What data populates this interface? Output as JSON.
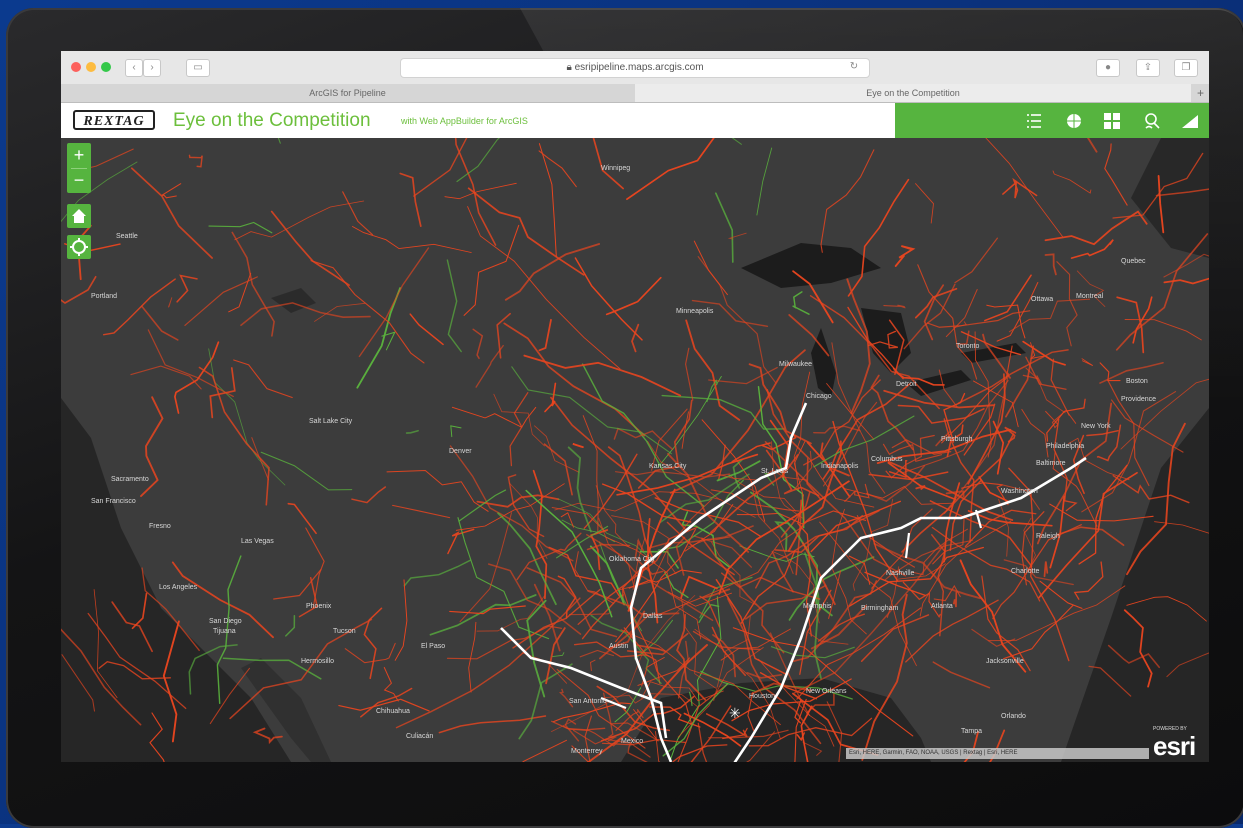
{
  "browser": {
    "url": "esripipeline.maps.arcgis.com",
    "tabs": [
      {
        "label": "ArcGIS for Pipeline",
        "active": false
      },
      {
        "label": "Eye on the Competition",
        "active": true
      }
    ]
  },
  "app": {
    "logo_text": "REXTAG",
    "title": "Eye on the Competition",
    "subtitle": "with Web AppBuilder for ArcGIS",
    "toolbar_icons": [
      "list-icon",
      "globe-icon",
      "grid-icon",
      "layers-icon",
      "signal-icon"
    ],
    "accent_color": "#56b43f"
  },
  "map_controls": {
    "zoom_in": "+",
    "zoom_out": "−"
  },
  "cities": [
    {
      "name": "Seattle"
    },
    {
      "name": "Portland"
    },
    {
      "name": "Winnipeg"
    },
    {
      "name": "Minneapolis"
    },
    {
      "name": "Milwaukee"
    },
    {
      "name": "Chicago"
    },
    {
      "name": "Detroit"
    },
    {
      "name": "Toronto"
    },
    {
      "name": "Ottawa"
    },
    {
      "name": "Montreal"
    },
    {
      "name": "Quebec"
    },
    {
      "name": "Boston"
    },
    {
      "name": "Providence"
    },
    {
      "name": "New York"
    },
    {
      "name": "Philadelphia"
    },
    {
      "name": "Baltimore"
    },
    {
      "name": "Washington"
    },
    {
      "name": "Pittsburgh"
    },
    {
      "name": "Columbus"
    },
    {
      "name": "Indianapolis"
    },
    {
      "name": "St. Louis"
    },
    {
      "name": "Kansas City"
    },
    {
      "name": "Denver"
    },
    {
      "name": "Salt Lake City"
    },
    {
      "name": "Las Vegas"
    },
    {
      "name": "Los Angeles"
    },
    {
      "name": "San Diego"
    },
    {
      "name": "Tijuana"
    },
    {
      "name": "San Francisco"
    },
    {
      "name": "Sacramento"
    },
    {
      "name": "Fresno"
    },
    {
      "name": "Phoenix"
    },
    {
      "name": "Tucson"
    },
    {
      "name": "El Paso"
    },
    {
      "name": "Chihuahua"
    },
    {
      "name": "Oklahoma City"
    },
    {
      "name": "Dallas"
    },
    {
      "name": "Austin"
    },
    {
      "name": "San Antonio"
    },
    {
      "name": "Houston"
    },
    {
      "name": "New Orleans"
    },
    {
      "name": "Memphis"
    },
    {
      "name": "Nashville"
    },
    {
      "name": "Atlanta"
    },
    {
      "name": "Birmingham"
    },
    {
      "name": "Charlotte"
    },
    {
      "name": "Raleigh"
    },
    {
      "name": "Jacksonville"
    },
    {
      "name": "Orlando"
    },
    {
      "name": "Tampa"
    },
    {
      "name": "Monterrey"
    },
    {
      "name": "Hermosillo"
    },
    {
      "name": "Culiacán"
    },
    {
      "name": "Mexico"
    }
  ],
  "attribution": "Esri, HERE, Garmin, FAO, NOAA, USGS | Rextag | Esri, HERE",
  "esri_powered": "POWERED BY",
  "esri_logo": "esri"
}
